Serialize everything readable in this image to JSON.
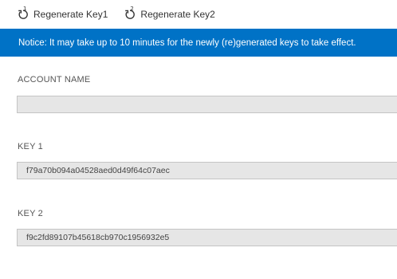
{
  "toolbar": {
    "regenerate_key1_label": "Regenerate Key1",
    "regenerate_key1_index": "1",
    "regenerate_key2_label": "Regenerate Key2",
    "regenerate_key2_index": "2"
  },
  "notice": {
    "text": "Notice: It may take up to 10 minutes for the newly (re)generated keys to take effect.",
    "background": "#0072c6"
  },
  "fields": {
    "account_name": {
      "label": "ACCOUNT NAME",
      "value": ""
    },
    "key1": {
      "label": "KEY 1",
      "value": "f79a70b094a04528aed0d49f64c07aec"
    },
    "key2": {
      "label": "KEY 2",
      "value": "f9c2fd89107b45618cb970c1956932e5"
    }
  }
}
